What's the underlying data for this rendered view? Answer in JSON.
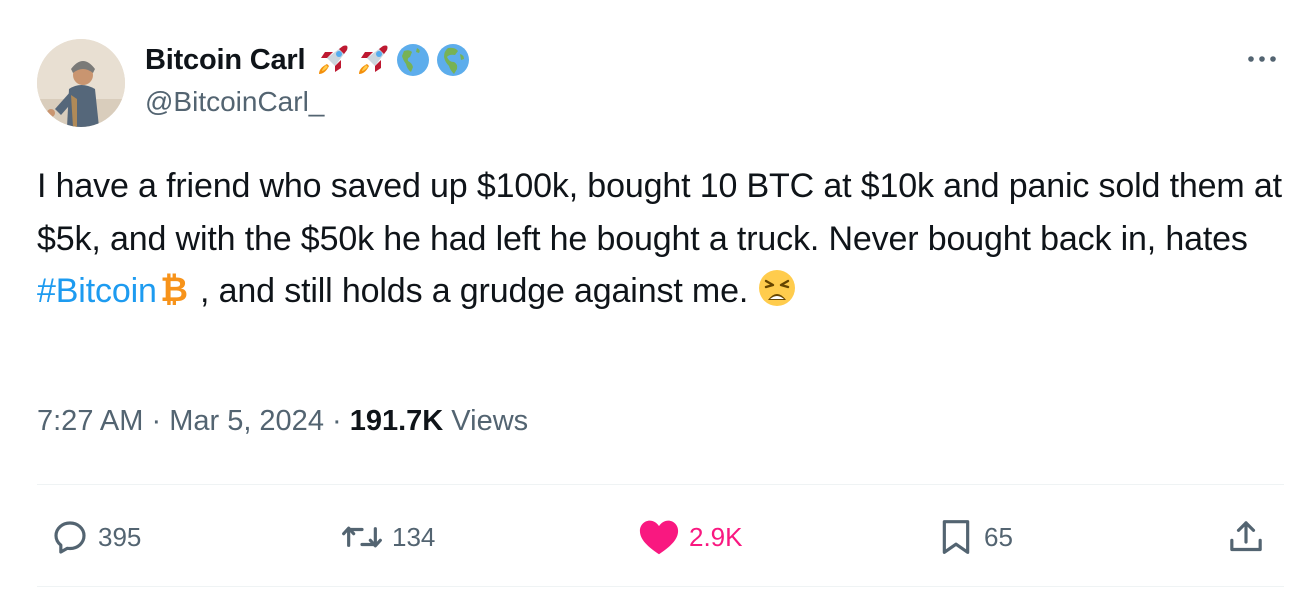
{
  "author": {
    "display_name": "Bitcoin Carl",
    "handle": "@BitcoinCarl_",
    "name_emojis": [
      "rocket-emoji",
      "rocket-emoji",
      "globe-americas-emoji",
      "globe-europe-africa-emoji"
    ]
  },
  "tweet": {
    "text_part1": "I have a friend who saved up $100k, bought 10 BTC at $10k and panic sold them at $5k, and with the $50k he had left he bought a truck. Never bought back in, hates ",
    "hashtag": "#Bitcoin",
    "text_part2": " , and still holds a grudge against me. ",
    "inline_icons": [
      "bitcoin-emoji",
      "weary-face-emoji"
    ]
  },
  "meta": {
    "time": "7:27 AM",
    "separator1": " · ",
    "date": "Mar 5, 2024",
    "separator2": " · ",
    "views_count": "191.7K",
    "views_label": " Views"
  },
  "actions": {
    "replies": "395",
    "retweets": "134",
    "likes": "2.9K",
    "bookmarks": "65"
  },
  "colors": {
    "hashtag": "#1d9bf0",
    "like": "#f91880",
    "secondary_text": "#536471",
    "bitcoin": "#f7931a"
  }
}
